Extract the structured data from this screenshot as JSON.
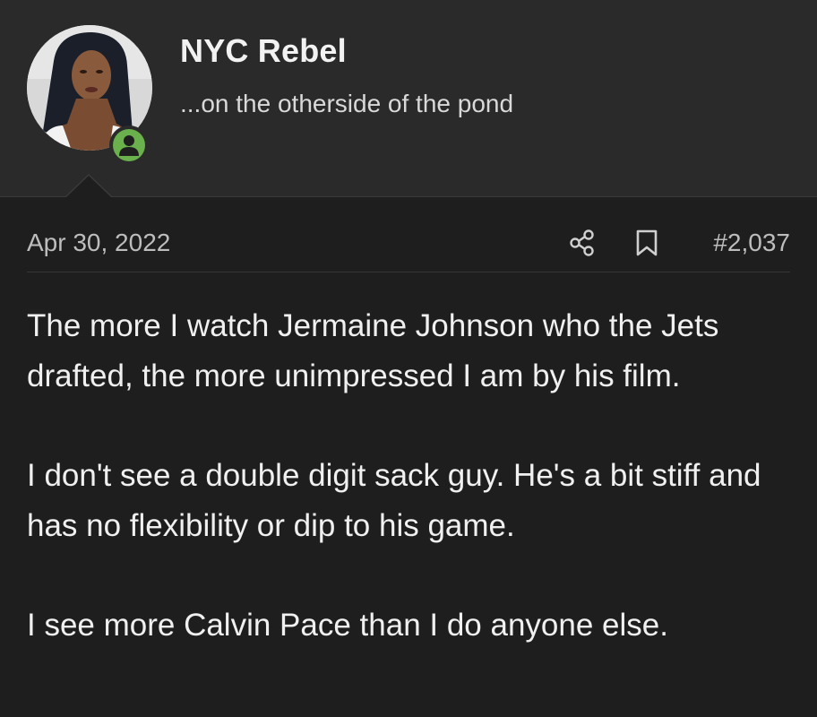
{
  "user": {
    "name": "NYC Rebel",
    "title": "...on the otherside of the pond",
    "avatar_icon": "user-avatar",
    "status_icon": "online-user-icon",
    "status_color": "#6ab04c"
  },
  "post": {
    "date": "Apr 30, 2022",
    "number": "#2,037",
    "share_icon": "share-icon",
    "bookmark_icon": "bookmark-icon",
    "paragraphs": [
      "The more I watch Jermaine Johnson who the Jets drafted, the more unimpressed I am by his film.",
      "I don't see a double digit sack guy. He's a bit stiff and has no flexibility or dip to his game.",
      "I see more Calvin Pace than I do anyone else."
    ]
  },
  "colors": {
    "header_bg": "#2a2a2a",
    "page_bg": "#1e1e1e",
    "text": "#f0f0f0",
    "muted": "#bdbdbd"
  }
}
